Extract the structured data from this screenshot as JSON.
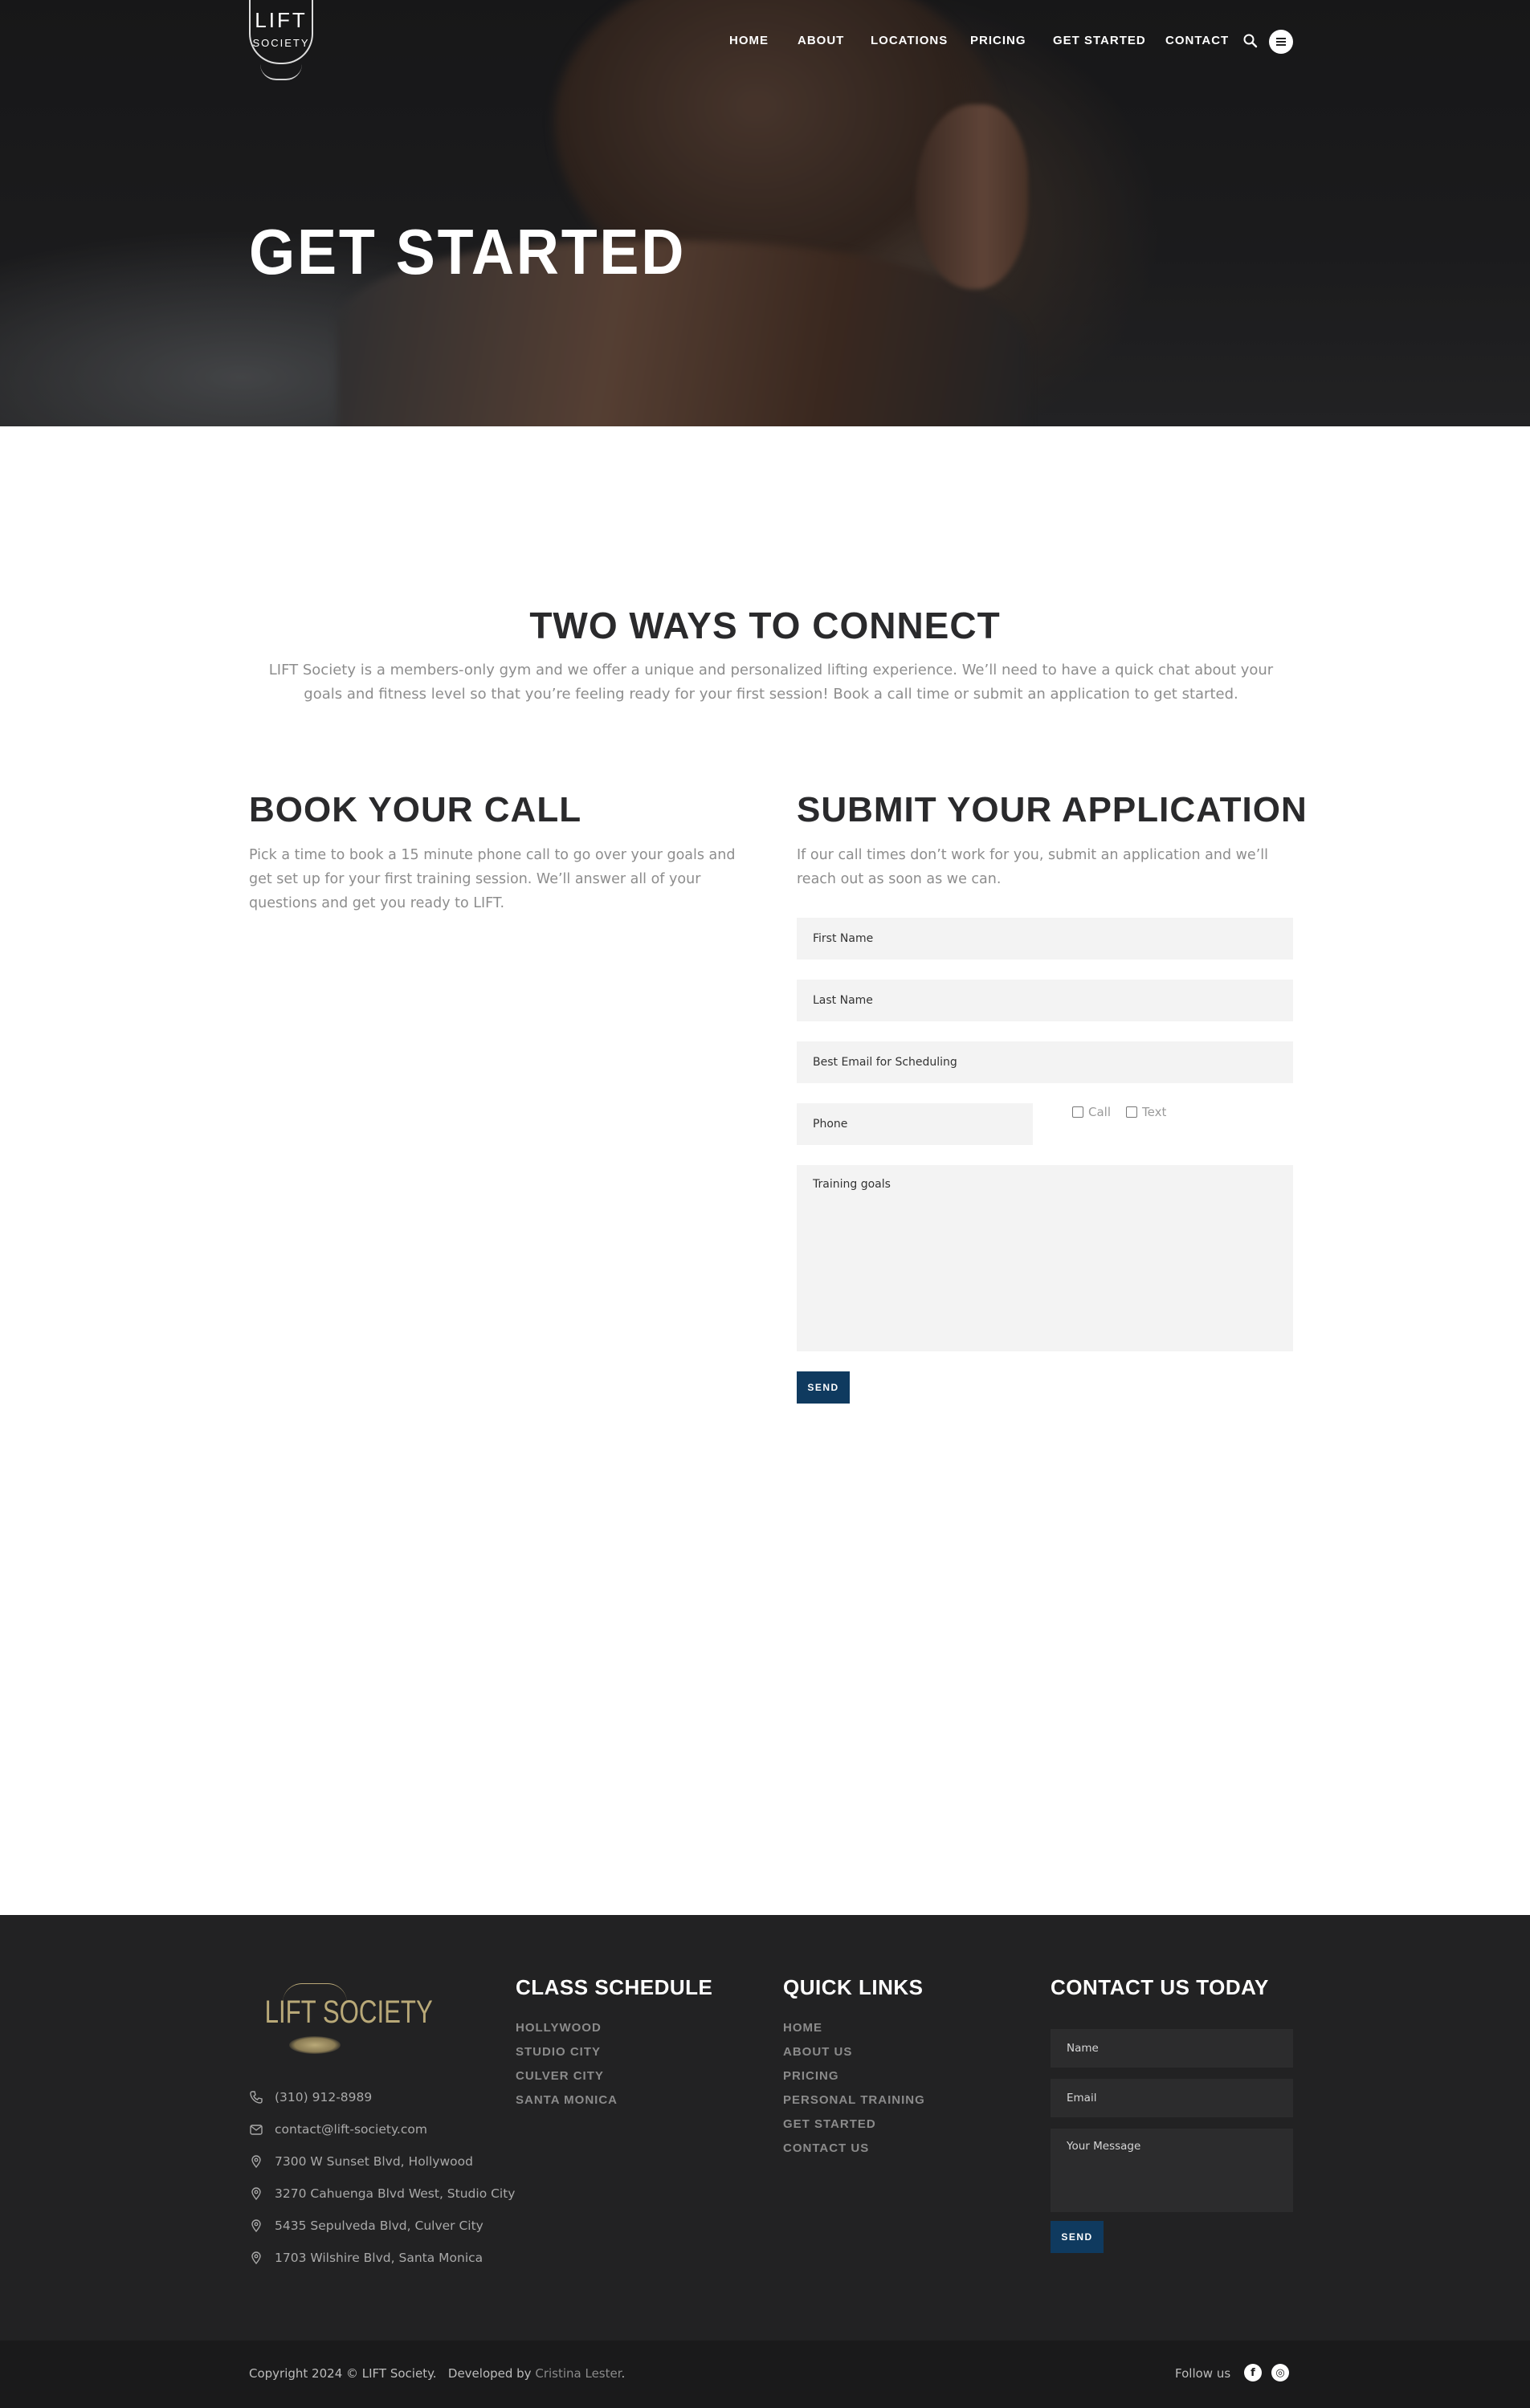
{
  "brand": {
    "logo_line1": "LIFT",
    "logo_line2": "SOCIETY",
    "footer_logo": "LIFT SOCIETY",
    "footer_logo_color": "#b9a978"
  },
  "nav": {
    "items": [
      {
        "label": "HOME"
      },
      {
        "label": "ABOUT"
      },
      {
        "label": "LOCATIONS"
      },
      {
        "label": "PRICING"
      },
      {
        "label": "GET STARTED"
      },
      {
        "label": "CONTACT"
      }
    ],
    "search_icon": "search-icon",
    "menu_icon": "hamburger-menu-icon"
  },
  "hero": {
    "title": "GET STARTED"
  },
  "connect": {
    "title": "TWO WAYS TO CONNECT",
    "intro": "LIFT Society is a members-only gym and we offer a unique and personalized lifting experience. We’ll need to have a quick chat about your goals and fitness level so that you’re feeling ready for your first session! Book a call time or submit an application to get started."
  },
  "book_call": {
    "title": "BOOK YOUR CALL",
    "text": "Pick a time to book a 15 minute phone call to go over your goals and get set up for your first training session. We’ll answer all of your questions and get you ready to LIFT."
  },
  "application": {
    "title": "SUBMIT YOUR APPLICATION",
    "text": "If our call times don’t work for you, submit an application and we’ll reach out as soon as we can.",
    "fields": {
      "first_name": "First Name",
      "last_name": "Last Name",
      "email": "Best Email for Scheduling",
      "phone": "Phone",
      "goals": "Training goals"
    },
    "options": {
      "call": "Call",
      "text": "Text"
    },
    "send_label": "SEND",
    "accent": "#0f3a5f"
  },
  "footer": {
    "contacts": [
      {
        "icon": "phone-icon",
        "text": "(310) 912-8989"
      },
      {
        "icon": "mail-icon",
        "text": "contact@lift-society.com"
      },
      {
        "icon": "location-pin-icon",
        "text": "7300 W Sunset Blvd, Hollywood"
      },
      {
        "icon": "location-pin-icon",
        "text": "3270 Cahuenga Blvd West, Studio City"
      },
      {
        "icon": "location-pin-icon",
        "text": "5435 Sepulveda Blvd, Culver City"
      },
      {
        "icon": "location-pin-icon",
        "text": "1703 Wilshire Blvd, Santa Monica"
      }
    ],
    "class_schedule": {
      "title": "CLASS SCHEDULE",
      "links": [
        "HOLLYWOOD",
        "STUDIO CITY",
        "CULVER CITY",
        "SANTA MONICA"
      ]
    },
    "quick_links": {
      "title": "QUICK LINKS",
      "links": [
        "HOME",
        "ABOUT US",
        "PRICING",
        "PERSONAL TRAINING",
        "GET STARTED",
        "CONTACT US"
      ]
    },
    "contact_form": {
      "title": "CONTACT US TODAY",
      "name_placeholder": "Name",
      "email_placeholder": "Email",
      "message_placeholder": "Your Message",
      "send_label": "SEND"
    },
    "copyright": "Copyright 2024 © LIFT Society.",
    "developed_by": "Developed by",
    "developer": "Cristina Lester",
    "period": ".",
    "follow_label": "Follow us",
    "social": [
      {
        "icon": "facebook-icon",
        "glyph": "f"
      },
      {
        "icon": "instagram-icon",
        "glyph": "◎"
      }
    ]
  }
}
